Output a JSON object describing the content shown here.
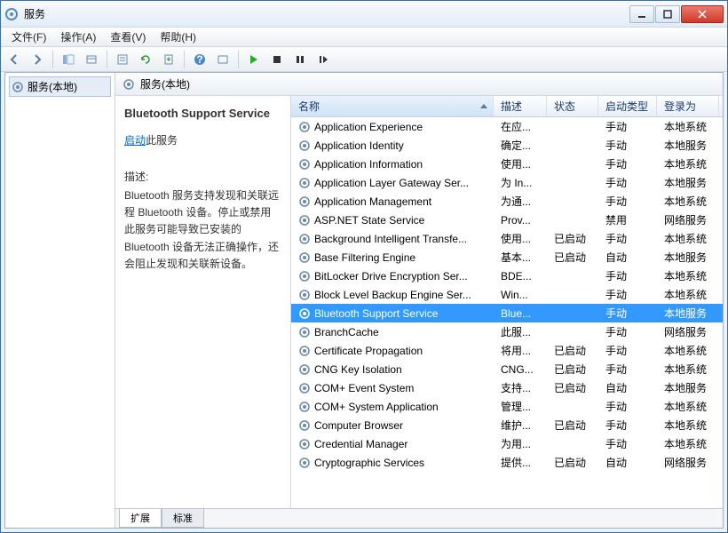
{
  "window": {
    "title": "服务"
  },
  "menu": {
    "file": "文件(F)",
    "action": "操作(A)",
    "view": "查看(V)",
    "help": "帮助(H)"
  },
  "nav": {
    "root": "服务(本地)"
  },
  "main_header": "服务(本地)",
  "detail": {
    "service_name": "Bluetooth Support Service",
    "start_link": "启动",
    "start_suffix": "此服务",
    "desc_label": "描述:",
    "desc_text": "Bluetooth 服务支持发现和关联远程 Bluetooth 设备。停止或禁用此服务可能导致已安装的 Bluetooth 设备无法正确操作，还会阻止发现和关联新设备。"
  },
  "columns": {
    "name": "名称",
    "desc": "描述",
    "status": "状态",
    "startup": "启动类型",
    "logon": "登录为"
  },
  "tabs": {
    "ext": "扩展",
    "std": "标准"
  },
  "services": [
    {
      "name": "Application Experience",
      "desc": "在应...",
      "status": "",
      "startup": "手动",
      "logon": "本地系统",
      "sel": false
    },
    {
      "name": "Application Identity",
      "desc": "确定...",
      "status": "",
      "startup": "手动",
      "logon": "本地服务",
      "sel": false
    },
    {
      "name": "Application Information",
      "desc": "使用...",
      "status": "",
      "startup": "手动",
      "logon": "本地系统",
      "sel": false
    },
    {
      "name": "Application Layer Gateway Ser...",
      "desc": "为 In...",
      "status": "",
      "startup": "手动",
      "logon": "本地服务",
      "sel": false
    },
    {
      "name": "Application Management",
      "desc": "为通...",
      "status": "",
      "startup": "手动",
      "logon": "本地系统",
      "sel": false
    },
    {
      "name": "ASP.NET State Service",
      "desc": "Prov...",
      "status": "",
      "startup": "禁用",
      "logon": "网络服务",
      "sel": false
    },
    {
      "name": "Background Intelligent Transfe...",
      "desc": "使用...",
      "status": "已启动",
      "startup": "手动",
      "logon": "本地系统",
      "sel": false
    },
    {
      "name": "Base Filtering Engine",
      "desc": "基本...",
      "status": "已启动",
      "startup": "自动",
      "logon": "本地服务",
      "sel": false
    },
    {
      "name": "BitLocker Drive Encryption Ser...",
      "desc": "BDE...",
      "status": "",
      "startup": "手动",
      "logon": "本地系统",
      "sel": false
    },
    {
      "name": "Block Level Backup Engine Ser...",
      "desc": "Win...",
      "status": "",
      "startup": "手动",
      "logon": "本地系统",
      "sel": false
    },
    {
      "name": "Bluetooth Support Service",
      "desc": "Blue...",
      "status": "",
      "startup": "手动",
      "logon": "本地服务",
      "sel": true
    },
    {
      "name": "BranchCache",
      "desc": "此服...",
      "status": "",
      "startup": "手动",
      "logon": "网络服务",
      "sel": false
    },
    {
      "name": "Certificate Propagation",
      "desc": "将用...",
      "status": "已启动",
      "startup": "手动",
      "logon": "本地系统",
      "sel": false
    },
    {
      "name": "CNG Key Isolation",
      "desc": "CNG...",
      "status": "已启动",
      "startup": "手动",
      "logon": "本地系统",
      "sel": false
    },
    {
      "name": "COM+ Event System",
      "desc": "支持...",
      "status": "已启动",
      "startup": "自动",
      "logon": "本地服务",
      "sel": false
    },
    {
      "name": "COM+ System Application",
      "desc": "管理...",
      "status": "",
      "startup": "手动",
      "logon": "本地系统",
      "sel": false
    },
    {
      "name": "Computer Browser",
      "desc": "维护...",
      "status": "已启动",
      "startup": "手动",
      "logon": "本地系统",
      "sel": false
    },
    {
      "name": "Credential Manager",
      "desc": "为用...",
      "status": "",
      "startup": "手动",
      "logon": "本地系统",
      "sel": false
    },
    {
      "name": "Cryptographic Services",
      "desc": "提供...",
      "status": "已启动",
      "startup": "自动",
      "logon": "网络服务",
      "sel": false
    }
  ]
}
